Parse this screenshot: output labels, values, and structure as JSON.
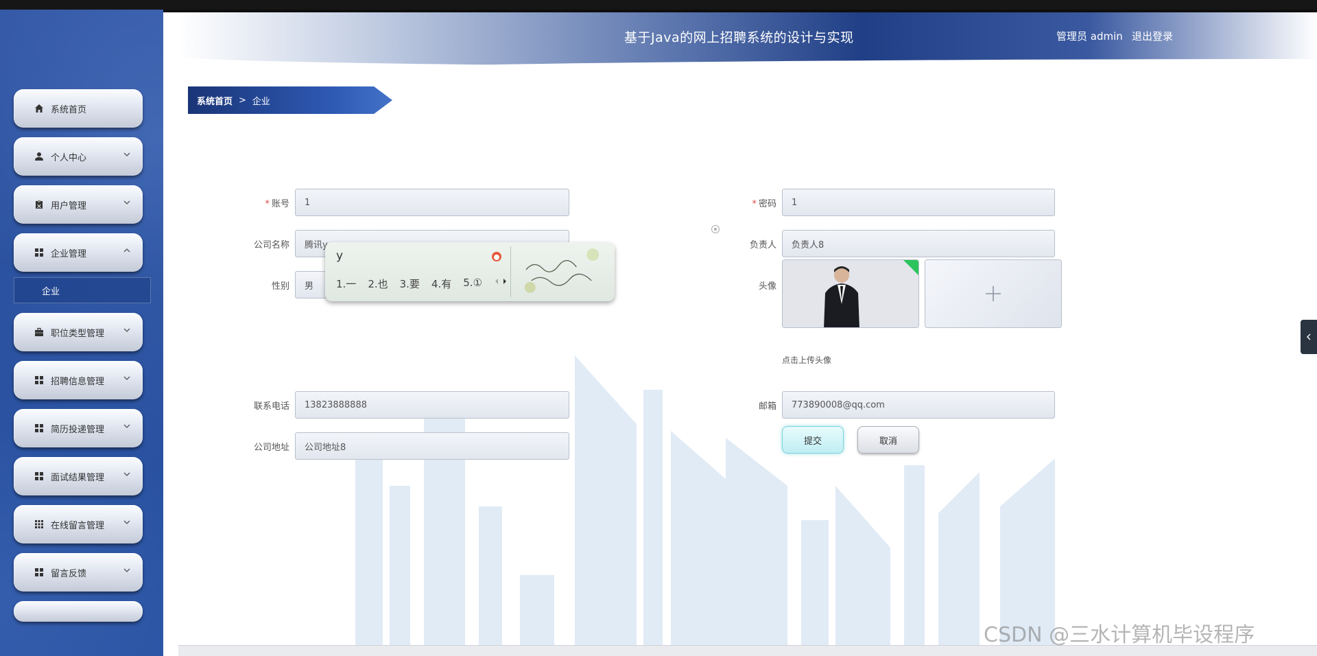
{
  "header": {
    "title": "基于Java的网上招聘系统的设计与实现",
    "user": "管理员 admin",
    "logout": "退出登录"
  },
  "sidebar": {
    "items": [
      {
        "label": "系统首页",
        "icon": "home-icon"
      },
      {
        "label": "个人中心",
        "icon": "user-icon"
      },
      {
        "label": "用户管理",
        "icon": "clipboard-icon"
      },
      {
        "label": "企业管理",
        "icon": "grid-icon"
      },
      {
        "label": "职位类型管理",
        "icon": "briefcase-icon"
      },
      {
        "label": "招聘信息管理",
        "icon": "grid-icon"
      },
      {
        "label": "简历投递管理",
        "icon": "grid-icon"
      },
      {
        "label": "面试结果管理",
        "icon": "grid-icon"
      },
      {
        "label": "在线留言管理",
        "icon": "apps-icon"
      },
      {
        "label": "留言反馈",
        "icon": "grid-icon"
      }
    ],
    "submenu": {
      "label": "企业"
    }
  },
  "breadcrumb": {
    "home": "系统首页",
    "separator": ">",
    "current": "企业"
  },
  "form": {
    "account": {
      "label": "账号",
      "value": "1"
    },
    "password": {
      "label": "密码",
      "value": "1"
    },
    "company_name": {
      "label": "公司名称",
      "value": "腾讯y"
    },
    "manager": {
      "label": "负责人",
      "value": "负责人8"
    },
    "gender": {
      "label": "性别",
      "value": "男"
    },
    "avatar": {
      "label": "头像",
      "hint": "点击上传头像"
    },
    "phone": {
      "label": "联系电话",
      "value": "13823888888"
    },
    "email": {
      "label": "邮箱",
      "value": "773890008@qq.com"
    },
    "address": {
      "label": "公司地址",
      "value": "公司地址8"
    },
    "submit": "提交",
    "cancel": "取消"
  },
  "ime": {
    "input": "y",
    "candidates": [
      "1.一",
      "2.也",
      "3.要",
      "4.有",
      "5.①"
    ]
  },
  "watermark": "CSDN @三水计算机毕设程序"
}
